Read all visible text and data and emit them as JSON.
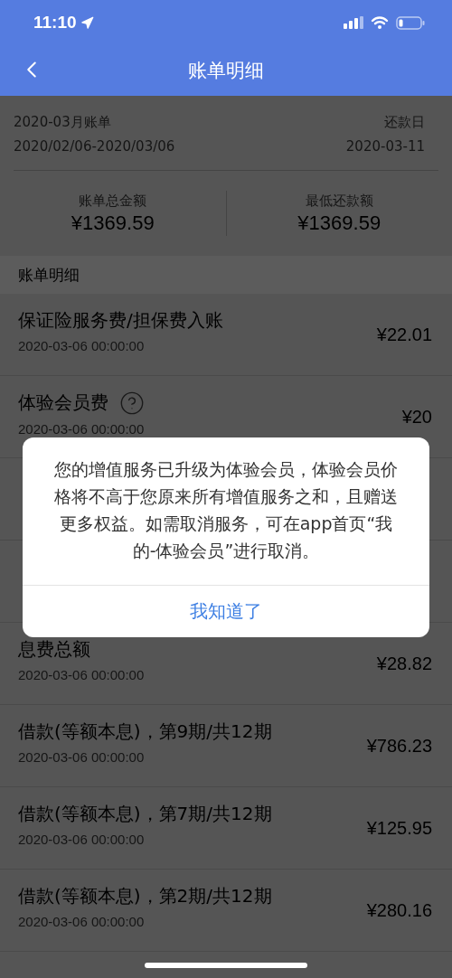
{
  "status_bar": {
    "time": "11:10"
  },
  "nav": {
    "title": "账单明细"
  },
  "bill": {
    "title": "2020-03月账单",
    "period": "2020/02/06-2020/03/06",
    "due_label": "还款日",
    "due_date": "2020-03-11"
  },
  "summary": [
    {
      "label": "账单总金额",
      "amount": "¥1369.59"
    },
    {
      "label": "最低还款额",
      "amount": "¥1369.59"
    }
  ],
  "section_title": "账单明细",
  "items": [
    {
      "kind": "entry",
      "title": "保证险服务费/担保费入账",
      "date": "2020-03-06 00:00:00",
      "amount": "¥22.01",
      "help": false
    },
    {
      "kind": "entry",
      "title": "体验会员费",
      "date": "2020-03-06 00:00:00",
      "amount": "¥20",
      "help": true
    },
    {
      "kind": "covered"
    },
    {
      "kind": "covered"
    },
    {
      "kind": "entry",
      "title": "息费总额",
      "date": "2020-03-06 00:00:00",
      "amount": "¥28.82",
      "help": false
    },
    {
      "kind": "entry",
      "title": "借款(等额本息)，第9期/共12期",
      "date": "2020-03-06 00:00:00",
      "amount": "¥786.23",
      "help": false
    },
    {
      "kind": "entry",
      "title": "借款(等额本息)，第7期/共12期",
      "date": "2020-03-06 00:00:00",
      "amount": "¥125.95",
      "help": false
    },
    {
      "kind": "entry",
      "title": "借款(等额本息)，第2期/共12期",
      "date": "2020-03-06 00:00:00",
      "amount": "¥280.16",
      "help": false
    }
  ],
  "dialog": {
    "message": "您的增值服务已升级为体验会员，体验会员价格将不高于您原来所有增值服务之和，且赠送更多权益。如需取消服务，可在app首页“我的-体验会员”进行取消。",
    "button": "我知道了"
  }
}
